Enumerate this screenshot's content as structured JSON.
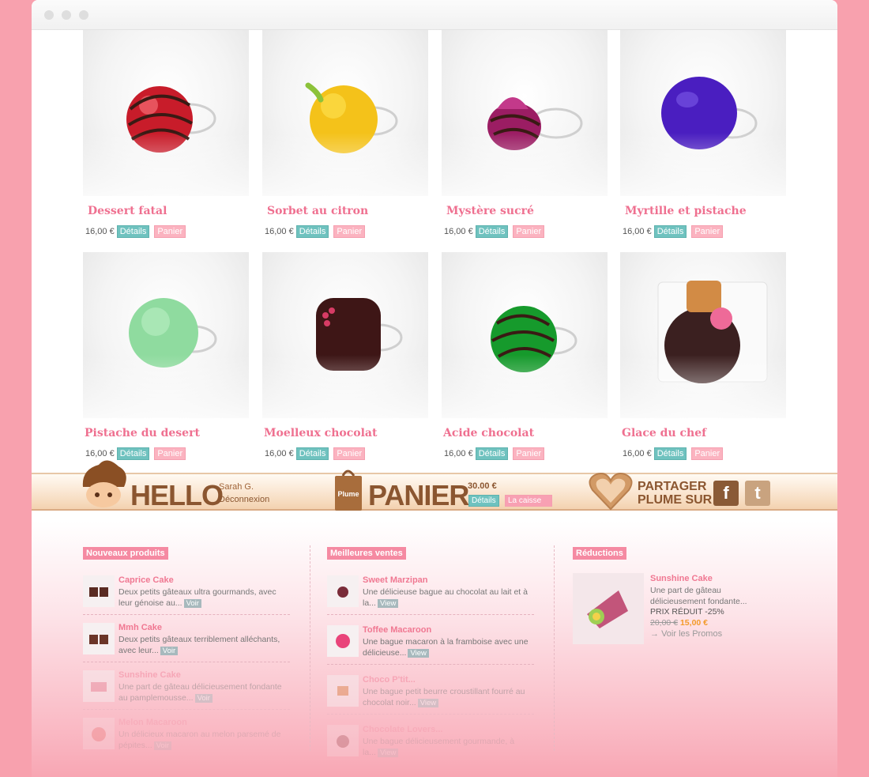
{
  "products": [
    {
      "name": "Dessert fatal",
      "price": "16,00 €",
      "details": "Détails",
      "panier": "Panier"
    },
    {
      "name": "Sorbet au citron",
      "price": "16,00 €",
      "details": "Détails",
      "panier": "Panier"
    },
    {
      "name": "Mystère sucré",
      "price": "16,00 €",
      "details": "Détails",
      "panier": "Panier"
    },
    {
      "name": "Myrtille et pistache",
      "price": "16,00 €",
      "details": "Détails",
      "panier": "Panier"
    },
    {
      "name": "Pistache du desert",
      "price": "16,00 €",
      "details": "Détails",
      "panier": "Panier"
    },
    {
      "name": "Moelleux chocolat",
      "price": "16,00 €",
      "details": "Détails",
      "panier": "Panier"
    },
    {
      "name": "Acide chocolat",
      "price": "16,00 €",
      "details": "Détails",
      "panier": "Panier"
    },
    {
      "name": "Glace du chef",
      "price": "16,00 €",
      "details": "Détails",
      "panier": "Panier"
    }
  ],
  "bar": {
    "hello": "HELLO",
    "user": "Sarah G.",
    "logout": "Déconnexion",
    "panier": "PANIER",
    "total": "30.00 €",
    "details": "Détails",
    "checkout": "La caisse",
    "share_line1": "PARTAGER",
    "share_line2": "PLUME SUR",
    "bag_label": "Plume",
    "facebook": "f",
    "twitter": "t"
  },
  "nouveaux": {
    "heading": "Nouveaux produits",
    "items": [
      {
        "title": "Caprice Cake",
        "desc": "Deux petits gâteaux ultra gourmands, avec leur génoise au...",
        "view": "Voir"
      },
      {
        "title": "Mmh Cake",
        "desc": "Deux petits gâteaux terriblement alléchants, avec leur...",
        "view": "Voir"
      },
      {
        "title": "Sunshine Cake",
        "desc": "Une part de gâteau délicieusement fondante au pamplemousse...",
        "view": "Voir"
      },
      {
        "title": "Melon Macaroon",
        "desc": "Un délicieux macaron au melon parsemé de pépites...",
        "view": "Voir"
      }
    ]
  },
  "meilleures": {
    "heading": "Meilleures ventes",
    "items": [
      {
        "title": "Sweet Marzipan",
        "desc": "Une délicieuse bague au chocolat au lait et à la...",
        "view": "View"
      },
      {
        "title": "Toffee Macaroon",
        "desc": "Une bague macaron à la framboise avec une délicieuse...",
        "view": "View"
      },
      {
        "title": "Choco P'tit...",
        "desc": "Une bague petit beurre croustillant fourré au chocolat noir...",
        "view": "View"
      },
      {
        "title": "Chocolate Lovers...",
        "desc": "Une bague délicieusement gourmande, à la...",
        "view": "View"
      }
    ]
  },
  "reductions": {
    "heading": "Réductions",
    "title": "Sunshine Cake",
    "desc": "Une part de gâteau délicieusement fondante...",
    "promo_label": "PRIX RÉDUIT -25%",
    "old_price": "20,00 €",
    "new_price": "15,00 €",
    "link": "Voir les Promos"
  },
  "colors": {
    "background": "#f8a1ae",
    "name_pink": "#ef7090",
    "details_teal": "#6fc2bf",
    "panier_pink": "#fbb3c0",
    "bar_brown": "#8b5630"
  }
}
